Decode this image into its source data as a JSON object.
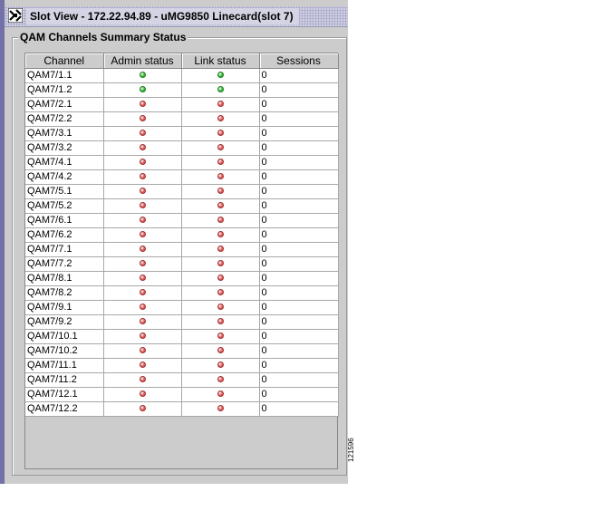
{
  "window": {
    "title": "Slot View - 172.22.94.89 - uMG9850 Linecard(slot 7)",
    "icon": "cisco-app-icon"
  },
  "group": {
    "title": "QAM Channels Summary Status"
  },
  "table": {
    "columns": [
      "Channel",
      "Admin status",
      "Link status",
      "Sessions"
    ],
    "rows": [
      {
        "channel": "QAM7/1.1",
        "admin": "up",
        "link": "up",
        "sessions": "0"
      },
      {
        "channel": "QAM7/1.2",
        "admin": "up",
        "link": "up",
        "sessions": "0"
      },
      {
        "channel": "QAM7/2.1",
        "admin": "down",
        "link": "down",
        "sessions": "0"
      },
      {
        "channel": "QAM7/2.2",
        "admin": "down",
        "link": "down",
        "sessions": "0"
      },
      {
        "channel": "QAM7/3.1",
        "admin": "down",
        "link": "down",
        "sessions": "0"
      },
      {
        "channel": "QAM7/3.2",
        "admin": "down",
        "link": "down",
        "sessions": "0"
      },
      {
        "channel": "QAM7/4.1",
        "admin": "down",
        "link": "down",
        "sessions": "0"
      },
      {
        "channel": "QAM7/4.2",
        "admin": "down",
        "link": "down",
        "sessions": "0"
      },
      {
        "channel": "QAM7/5.1",
        "admin": "down",
        "link": "down",
        "sessions": "0"
      },
      {
        "channel": "QAM7/5.2",
        "admin": "down",
        "link": "down",
        "sessions": "0"
      },
      {
        "channel": "QAM7/6.1",
        "admin": "down",
        "link": "down",
        "sessions": "0"
      },
      {
        "channel": "QAM7/6.2",
        "admin": "down",
        "link": "down",
        "sessions": "0"
      },
      {
        "channel": "QAM7/7.1",
        "admin": "down",
        "link": "down",
        "sessions": "0"
      },
      {
        "channel": "QAM7/7.2",
        "admin": "down",
        "link": "down",
        "sessions": "0"
      },
      {
        "channel": "QAM7/8.1",
        "admin": "down",
        "link": "down",
        "sessions": "0"
      },
      {
        "channel": "QAM7/8.2",
        "admin": "down",
        "link": "down",
        "sessions": "0"
      },
      {
        "channel": "QAM7/9.1",
        "admin": "down",
        "link": "down",
        "sessions": "0"
      },
      {
        "channel": "QAM7/9.2",
        "admin": "down",
        "link": "down",
        "sessions": "0"
      },
      {
        "channel": "QAM7/10.1",
        "admin": "down",
        "link": "down",
        "sessions": "0"
      },
      {
        "channel": "QAM7/10.2",
        "admin": "down",
        "link": "down",
        "sessions": "0"
      },
      {
        "channel": "QAM7/11.1",
        "admin": "down",
        "link": "down",
        "sessions": "0"
      },
      {
        "channel": "QAM7/11.2",
        "admin": "down",
        "link": "down",
        "sessions": "0"
      },
      {
        "channel": "QAM7/12.1",
        "admin": "down",
        "link": "down",
        "sessions": "0"
      },
      {
        "channel": "QAM7/12.2",
        "admin": "down",
        "link": "down",
        "sessions": "0"
      }
    ]
  },
  "colors": {
    "up": "#33bb33",
    "down": "#e05a5a"
  },
  "figure_id": "121596"
}
